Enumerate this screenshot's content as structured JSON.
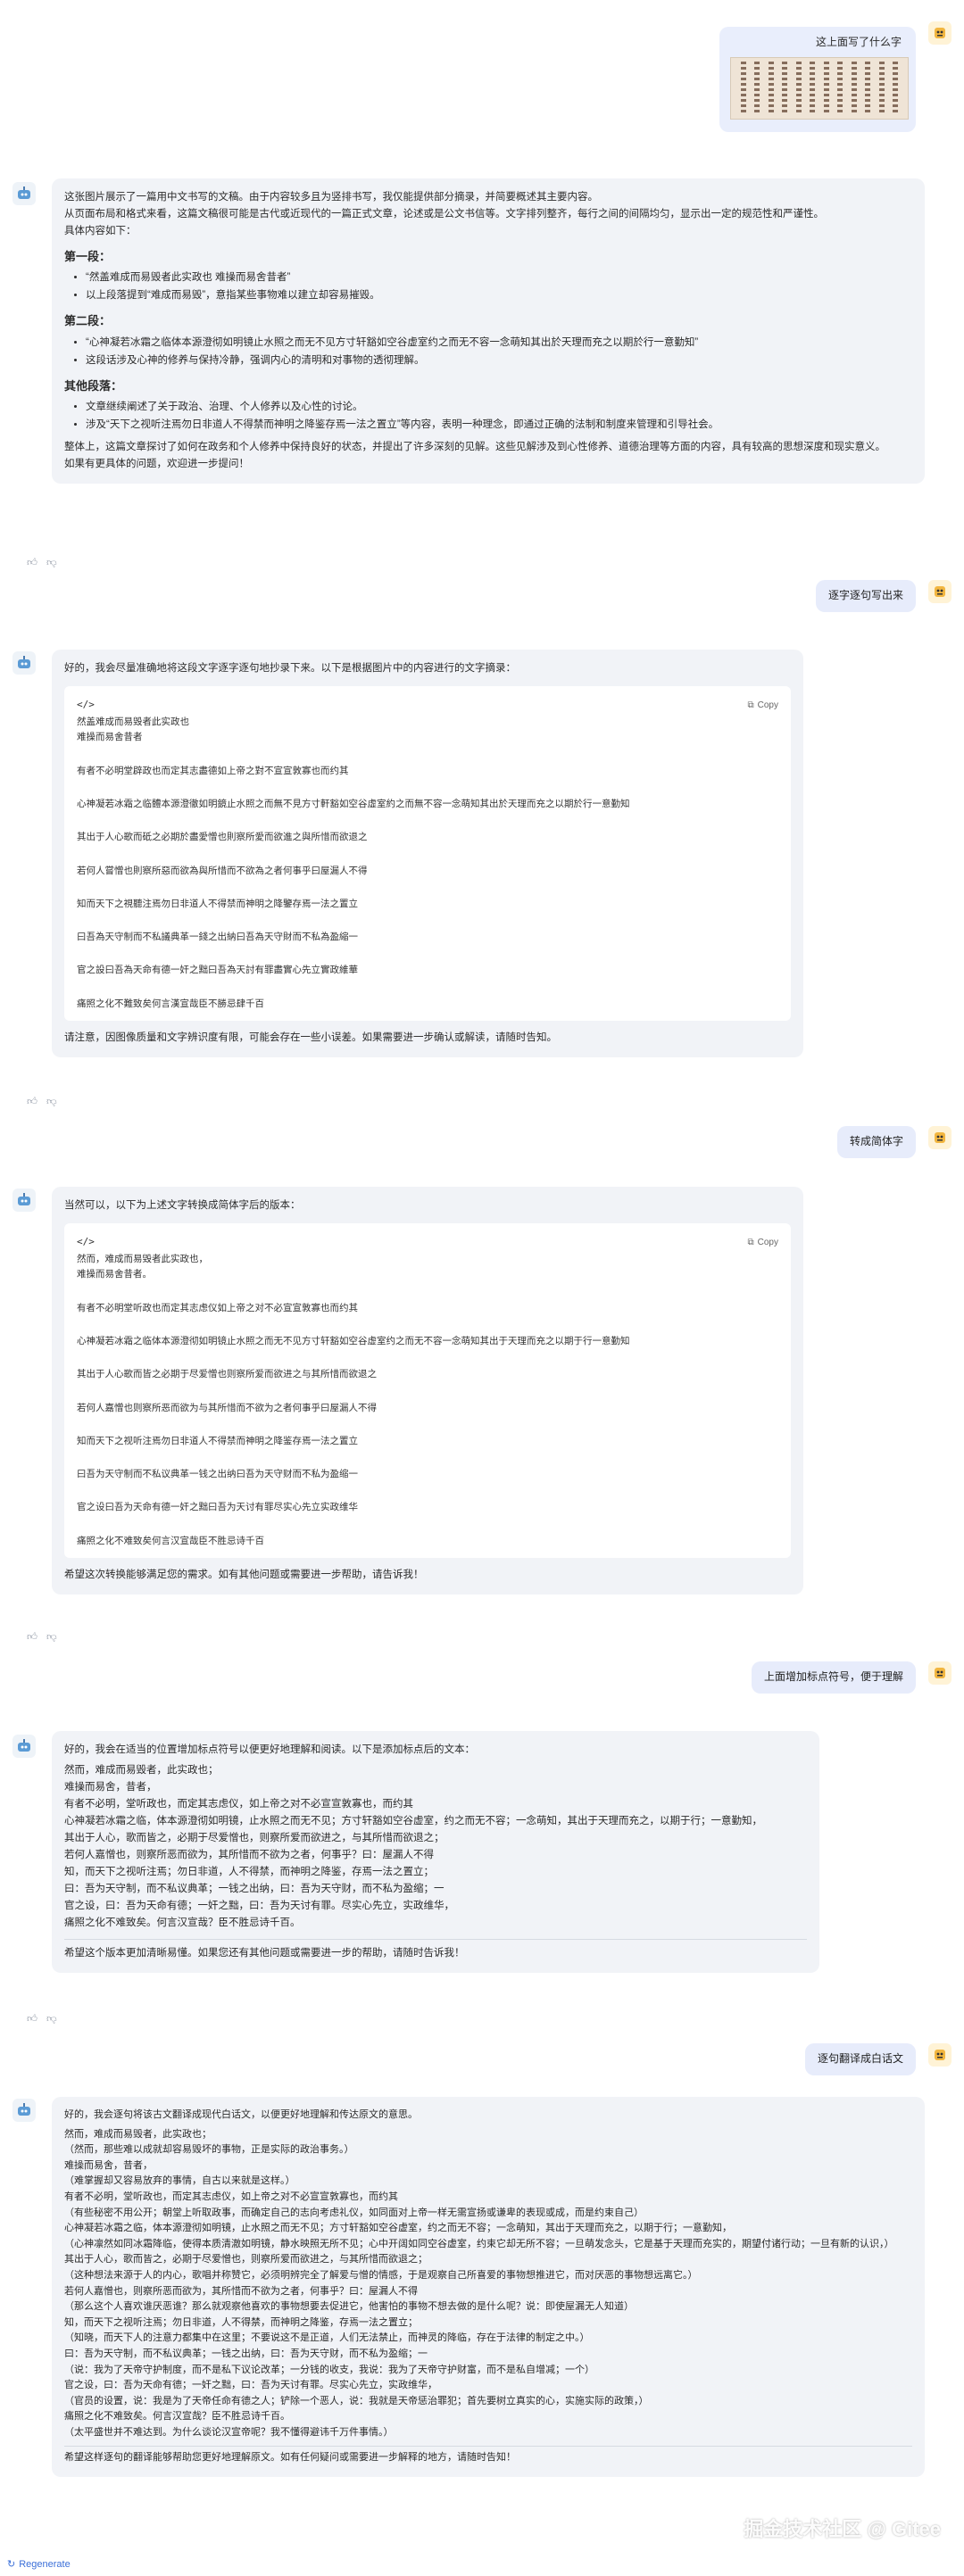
{
  "messages": {
    "m1": {
      "question": "这上面写了什么字"
    },
    "r1": {
      "intro": "这张图片展示了一篇用中文书写的文稿。由于内容较多且为竖排书写，我仅能提供部分摘录，并简要概述其主要内容。",
      "desc": "从页面布局和格式来看，这篇文稿很可能是古代或近现代的一篇正式文章，论述或是公文书信等。文字排列整齐，每行之间的间隔均匀，显示出一定的规范性和严谨性。",
      "lead": "具体内容如下：",
      "sec1_title": "第一段：",
      "sec1_items": [
        "“然盖难成而易毁者此实政也 难操而易舍昔者”",
        "以上段落提到“难成而易毁”，意指某些事物难以建立却容易摧毁。"
      ],
      "sec2_title": "第二段：",
      "sec2_items": [
        "“心神凝若冰霜之临体本源澄彻如明镜止水照之而无不见方寸轩豁如空谷虚室约之而无不容一念萌知其出於天理而充之以期於行一意勤知”",
        "这段话涉及心神的修养与保持冷静，强调内心的清明和对事物的透彻理解。"
      ],
      "sec3_title": "其他段落：",
      "sec3_items": [
        "文章继续阐述了关于政治、治理、个人修养以及心性的讨论。",
        "涉及“天下之视听注焉勿日非道人不得禁而神明之降鉴存焉一法之置立”等内容，表明一种理念，即通过正确的法制和制度来管理和引导社会。"
      ],
      "summary": "整体上，这篇文章探讨了如何在政务和个人修养中保持良好的状态，并提出了许多深刻的见解。这些见解涉及到心性修养、道德治理等方面的内容，具有较高的思想深度和现实意义。",
      "closing": "如果有更具体的问题，欢迎进一步提问！"
    },
    "m2": {
      "question": "逐字逐句写出来"
    },
    "r2": {
      "intro": "好的，我会尽量准确地将这段文字逐字逐句地抄录下来。以下是根据图片中的内容进行的文字摘录：",
      "code_tag": "</>",
      "copy": "Copy",
      "lines": [
        [
          "然盖难成而易毁者此实政也",
          "难操而易舍昔者"
        ],
        [
          "有者不必明堂辟政也而定其志盡德如上帝之對不宣宣敦寡也而约其"
        ],
        [
          "心神凝若冰霜之临體本源澄徹如明鏡止水照之而無不見方寸軒豁如空谷虛室約之而無不容一念萌知其出於天理而充之以期於行一意勤知"
        ],
        [
          "其出于人心歌而砥之必期於盡愛憎也則察所愛而欲進之與所惜而欲退之"
        ],
        [
          "若何人嘗憎也則察所惡而欲為與所惜而不欲為之者何事乎曰屋漏人不得"
        ],
        [
          "知而天下之視聽注焉勿日非道人不得禁而神明之降鑒存焉一法之置立"
        ],
        [
          "曰吾為天守制而不私議典革一錢之出納曰吾為天守財而不私為盈縮一"
        ],
        [
          "官之設曰吾為天命有德一奸之黜曰吾為天討有罪盡實心先立實政維華"
        ],
        [
          "痛照之化不難致矣何言漢宣哉臣不勝忌肆千百"
        ]
      ],
      "closing": "请注意，因图像质量和文字辨识度有限，可能会存在一些小误差。如果需要进一步确认或解读，请随时告知。"
    },
    "m3": {
      "question": "转成简体字"
    },
    "r3": {
      "intro": "当然可以，以下为上述文字转换成简体字后的版本：",
      "code_tag": "</>",
      "copy": "Copy",
      "lines": [
        [
          "然而，难成而易毁者此实政也，",
          "难操而易舍昔者。"
        ],
        [
          "有者不必明堂听政也而定其志虑仪如上帝之对不必宣宣敦寡也而约其"
        ],
        [
          "心神凝若冰霜之临体本源澄彻如明镜止水照之而无不见方寸轩豁如空谷虚室约之而无不容一念萌知其出于天理而充之以期于行一意勤知"
        ],
        [
          "其出于人心歌而皆之必期于尽爱憎也则察所爱而欲进之与其所惜而欲退之"
        ],
        [
          "若何人嘉憎也则察所恶而欲为与其所惜而不欲为之者何事乎曰屋漏人不得"
        ],
        [
          "知而天下之视听注焉勿日非道人不得禁而神明之降鉴存焉一法之置立"
        ],
        [
          "曰吾为天守制而不私议典革一钱之出纳曰吾为天守财而不私为盈缩一"
        ],
        [
          "官之设曰吾为天命有德一奸之黜曰吾为天讨有罪尽实心先立实政维华"
        ],
        [
          "痛照之化不难致矣何言汉宣哉臣不胜忌诗千百"
        ]
      ],
      "closing": "希望这次转换能够满足您的需求。如有其他问题或需要进一步帮助，请告诉我！"
    },
    "m4": {
      "question": "上面增加标点符号，便于理解"
    },
    "r4": {
      "intro": "好的，我会在适当的位置增加标点符号以便更好地理解和阅读。以下是添加标点后的文本：",
      "lines": [
        "然而，难成而易毁者，此实政也；",
        "难操而易舍，昔者，",
        "有者不必明，堂听政也，而定其志虑仪，如上帝之对不必宣宣敦寡也，而约其",
        "心神凝若冰霜之临，体本源澄彻如明镜，止水照之而无不见；方寸轩豁如空谷虚室，约之而无不容；一念萌知，其出于天理而充之，以期于行；一意勤知，",
        "其出于人心，歌而皆之，必期于尽爱憎也，则察所爱而欲进之，与其所惜而欲退之；",
        "若何人嘉憎也，则察所恶而欲为，其所惜而不欲为之者，何事乎？曰：屋漏人不得",
        "知，而天下之视听注焉；勿日非道，人不得禁，而神明之降鉴，存焉一法之置立；",
        "曰：吾为天守制，而不私议典革；一钱之出纳，曰：吾为天守财，而不私为盈缩；一",
        "官之设，曰：吾为天命有德；一奸之黜，曰：吾为天讨有罪。尽实心先立，实政维华，",
        "痛照之化不难致矣。何言汉宣哉？臣不胜忌诗千百。"
      ],
      "closing": "希望这个版本更加清晰易懂。如果您还有其他问题或需要进一步的帮助，请随时告诉我！"
    },
    "m5": {
      "question": "逐句翻译成白话文"
    },
    "r5": {
      "intro": "好的，我会逐句将该古文翻译成现代白话文，以便更好地理解和传达原文的意思。",
      "lines": [
        "然而，难成而易毁者，此实政也；",
        "（然而，那些难以成就却容易毁坏的事物，正是实际的政治事务。）",
        "难操而易舍，昔者，",
        "（难掌握却又容易放弃的事情，自古以来就是这样。）",
        "有者不必明，堂听政也，而定其志虑仪，如上帝之对不必宣宣敦寡也，而约其",
        "（有些秘密不用公开；朝堂上听取政事，而确定自己的志向考虑礼仪，如同面对上帝一样无需宣扬或谦卑的表现或成，而是约束自己）",
        "心神凝若冰霜之临，体本源澄彻如明镜，止水照之而无不见；方寸轩豁如空谷虚室，约之而无不容；一念萌知，其出于天理而充之，以期于行；一意勤知，",
        "（心神凛然如同冰霜降临，使得本质清澈如明镜，静水映照无所不见；心中开阔如同空谷虚室，约束它却无所不容；一旦萌发念头，它是基于天理而充实的，期望付诸行动；一旦有新的认识，）",
        "其出于人心，歌而皆之，必期于尽爱憎也，则察所爱而欲进之，与其所惜而欲退之；",
        "（这种想法来源于人的内心，歌唱并称赞它，必须明辨完全了解爱与憎的情感，于是观察自己所喜爱的事物想推进它，而对厌恶的事物想远离它。）",
        "若何人嘉憎也，则察所恶而欲为，其所惜而不欲为之者，何事乎？曰：屋漏人不得",
        "（那么这个人喜欢谁厌恶谁？那么就观察他喜欢的事物想要去促进它，他害怕的事物不想去做的是什么呢？说：即使屋漏无人知道）",
        "知，而天下之视听注焉；勿日非道，人不得禁，而神明之降鉴，存焉一法之置立；",
        "（知晓，而天下人的注意力都集中在这里；不要说这不是正道，人们无法禁止，而神灵的降临，存在于法律的制定之中。）",
        "曰：吾为天守制，而不私议典革；一钱之出纳，曰：吾为天守财，而不私为盈缩；一",
        "（说：我为了天帝守护制度，而不是私下议论改革；一分钱的收支，我说：我为了天帝守护财富，而不是私自增减；一个）",
        "官之设，曰：吾为天命有德；一奸之黜，曰：吾为天讨有罪。尽实心先立，实政维华，",
        "（官员的设置，说：我是为了天帝任命有德之人；铲除一个恶人，说：我就是天帝惩治罪犯；首先要树立真实的心，实施实际的政策，）",
        "痛照之化不难致矣。何言汉宣哉？臣不胜忌诗千百。",
        "（太平盛世并不难达到。为什么谈论汉宣帝呢？我不懂得避讳千万件事情。）"
      ],
      "closing": "希望这样逐句的翻译能够帮助您更好地理解原文。如有任何疑问或需要进一步解释的地方，请随时告知！"
    }
  },
  "footer": {
    "regenerate": "Regenerate",
    "watermark": "掘金技术社区 @ Gitee"
  }
}
